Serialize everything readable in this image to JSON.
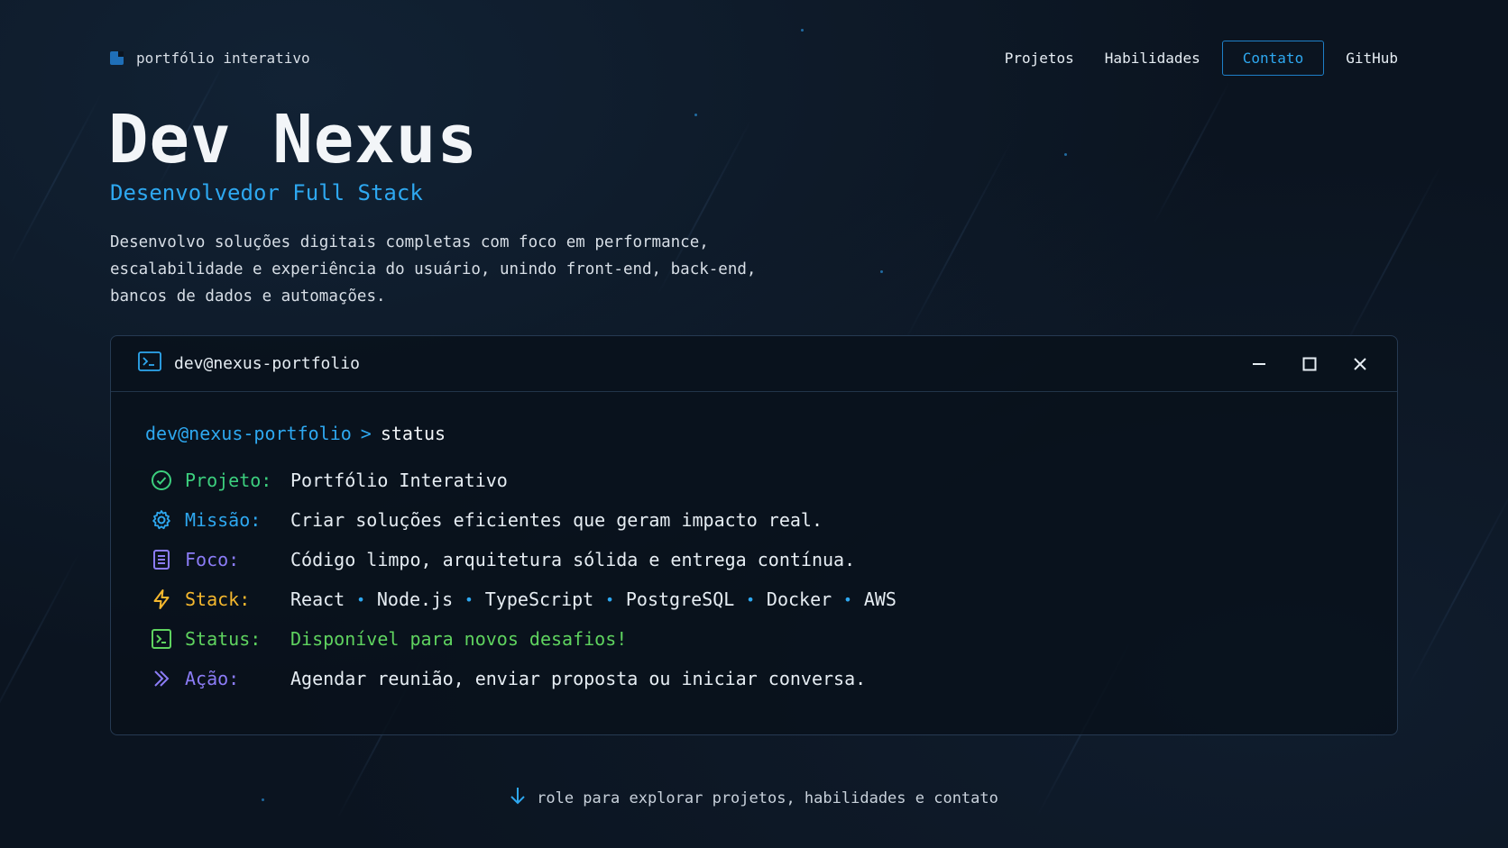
{
  "brand": {
    "label": "portfólio interativo"
  },
  "nav": {
    "links": [
      {
        "label": "Projetos"
      },
      {
        "label": "Habilidades"
      },
      {
        "label": "Contato"
      },
      {
        "label": "GitHub"
      }
    ]
  },
  "hero": {
    "title": "Dev Nexus",
    "subtitle": "Desenvolvedor Full Stack",
    "description": "Desenvolvo soluções digitais completas com foco em performance, escalabilidade e experiência do usuário, unindo front-end, back-end, bancos de dados e automações."
  },
  "terminal": {
    "title": "dev@nexus-portfolio",
    "prompt_user": "dev@nexus-portfolio",
    "prompt_arrow": ">",
    "command": "status",
    "rows": {
      "projeto": {
        "label": "Projeto:",
        "value": "Portfólio Interativo",
        "icon": "check-circle-icon",
        "color": "#3ccf7e"
      },
      "missao": {
        "label": "Missão:",
        "value": "Criar soluções eficientes que geram impacto real.",
        "icon": "gear-icon",
        "color": "#2ea8f0"
      },
      "foco": {
        "label": "Foco:",
        "value": "Código limpo, arquitetura sólida e entrega contínua.",
        "icon": "document-icon",
        "color": "#8b7cf6"
      },
      "stack": {
        "label": "Stack:",
        "icon": "lightning-icon",
        "color": "#f5b82e",
        "items": [
          "React",
          "Node.js",
          "TypeScript",
          "PostgreSQL",
          "Docker",
          "AWS"
        ]
      },
      "status": {
        "label": "Status:",
        "value": "Disponível para novos desafios!",
        "icon": "terminal-icon",
        "color": "#5fd35f"
      },
      "acao": {
        "label": "Ação:",
        "value": "Agendar reunião, enviar proposta ou iniciar conversa.",
        "icon": "chevron-right-icon",
        "color": "#8b7cf6"
      }
    }
  },
  "hint": {
    "label": "role para explorar projetos, habilidades e contato"
  },
  "colors": {
    "accent": "#2ea8f0",
    "background": "#0b1420"
  }
}
